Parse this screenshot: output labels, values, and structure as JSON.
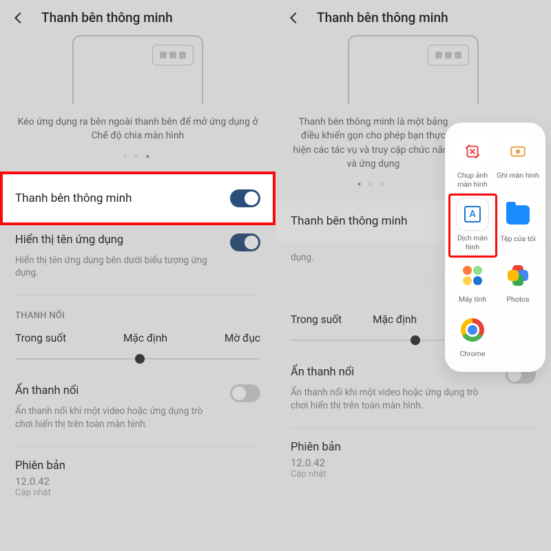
{
  "left": {
    "header_title": "Thanh bên thông minh",
    "desc": "Kéo ứng dụng ra bên ngoài thanh bên để mở ứng dụng ở Chế độ chia màn hình",
    "dots": "○ ○ ●",
    "toggle_main": "Thanh bên thông minh",
    "appname_title": "Hiển thị tên ứng dụng",
    "appname_sub": "Hiển thị tên ứng dụng bên dưới biểu tượng ứng dụng.",
    "section_bar": "THANH NỔI",
    "slider_a": "Trong suốt",
    "slider_b": "Mặc định",
    "slider_c": "Mờ đục",
    "hide_title": "Ẩn thanh nổi",
    "hide_sub": "Ẩn thanh nổi khi một video hoặc ứng dụng trò chơi hiển thị trên toàn màn hình.",
    "ver_title": "Phiên bản",
    "ver_num": "12.0.42",
    "ver_sub": "Cập nhật"
  },
  "right": {
    "header_title": "Thanh bên thông minh",
    "desc": "Thanh bên thông minh là một bảng điều khiển gọn cho phép bạn thực hiện các tác vụ và truy cập chức năng và ứng dụng",
    "dots": "● ○ ○",
    "toggle_main": "Thanh bên thông minh",
    "appname_sub": "dụng.",
    "slider_a": "Trong suốt",
    "slider_b": "Mặc định",
    "hide_title": "Ẩn thanh nổi",
    "hide_sub": "Ẩn thanh nổi khi một video hoặc ứng dụng trò chơi hiển thị trên toàn màn hình.",
    "ver_title": "Phiên bản",
    "ver_num": "12.0.42",
    "ver_sub": "Cập nhật"
  },
  "sidebar": {
    "items": [
      {
        "label": "Chụp ảnh màn hình"
      },
      {
        "label": "Ghi màn hình"
      },
      {
        "label": "Dịch màn hình"
      },
      {
        "label": "Tệp của tôi"
      },
      {
        "label": "Máy tính"
      },
      {
        "label": "Photos"
      },
      {
        "label": "Chrome"
      }
    ],
    "a_letter": "A"
  }
}
